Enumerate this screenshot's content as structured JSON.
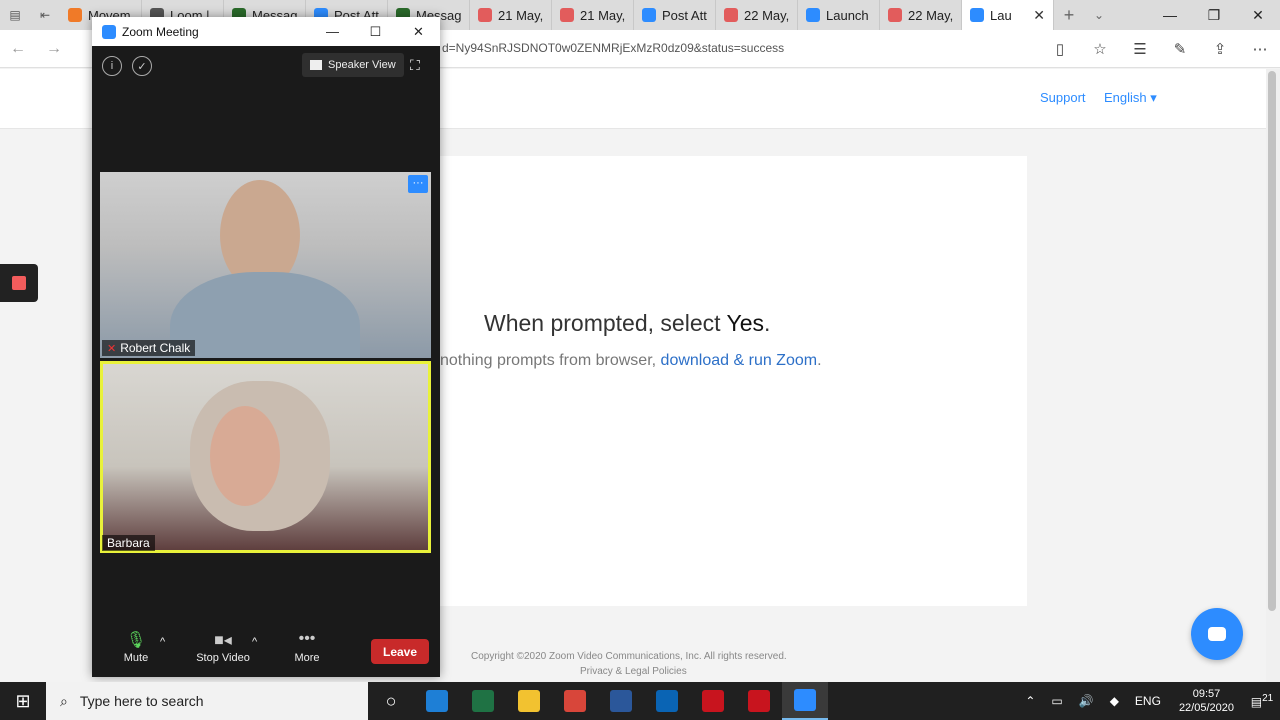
{
  "browser": {
    "tabs": [
      {
        "label": "Movem",
        "color": "#f07a28"
      },
      {
        "label": "Loom |",
        "color": "#555555"
      },
      {
        "label": "Messag",
        "color": "#2a6a2a"
      },
      {
        "label": "Post Att",
        "color": "#2d8cff"
      },
      {
        "label": "Messag",
        "color": "#2a6a2a"
      },
      {
        "label": "21 May,",
        "color": "#e25c5c"
      },
      {
        "label": "21 May,",
        "color": "#e25c5c"
      },
      {
        "label": "Post Att",
        "color": "#2d8cff"
      },
      {
        "label": "22 May,",
        "color": "#e25c5c"
      },
      {
        "label": "Launch",
        "color": "#2d8cff"
      },
      {
        "label": "22 May,",
        "color": "#e25c5c"
      }
    ],
    "active_tab": {
      "label": "Lau",
      "color": "#2d8cff"
    },
    "url": "d=Ny94SnRJSDNOT0w0ZENMRjExMzR0dz09&status=success"
  },
  "page": {
    "support": "Support",
    "language": "English",
    "prompt_lead": "When prompted, select ",
    "prompt_yes": "Yes",
    "prompt_end": ".",
    "sub_lead": "nothing prompts from browser, ",
    "sub_link": "download & run Zoom",
    "sub_end": ".",
    "copyright": "Copyright ©2020 Zoom Video Communications, Inc. All rights reserved.",
    "policies": "Privacy & Legal Policies"
  },
  "zoom": {
    "title": "Zoom Meeting",
    "speaker_view": "Speaker View",
    "participants": [
      {
        "name": "Robert Chalk",
        "muted": true
      },
      {
        "name": "Barbara",
        "muted": false,
        "speaking": true
      }
    ],
    "controls": {
      "mute": "Mute",
      "stop_video": "Stop Video",
      "more": "More",
      "leave": "Leave"
    }
  },
  "taskbar": {
    "search_placeholder": "Type here to search",
    "apps": [
      {
        "name": "edge",
        "color": "#1e7fd6"
      },
      {
        "name": "excel",
        "color": "#1f7244"
      },
      {
        "name": "file-explorer",
        "color": "#f2c230"
      },
      {
        "name": "chrome",
        "color": "#d8463a"
      },
      {
        "name": "word",
        "color": "#2b579a"
      },
      {
        "name": "outlook",
        "color": "#0a64b4"
      },
      {
        "name": "acrobat",
        "color": "#c8141e"
      },
      {
        "name": "app-red",
        "color": "#c8141e"
      },
      {
        "name": "zoom",
        "color": "#2d8cff"
      }
    ],
    "language": "ENG",
    "time": "09:57",
    "date": "22/05/2020",
    "notifications": "21"
  }
}
